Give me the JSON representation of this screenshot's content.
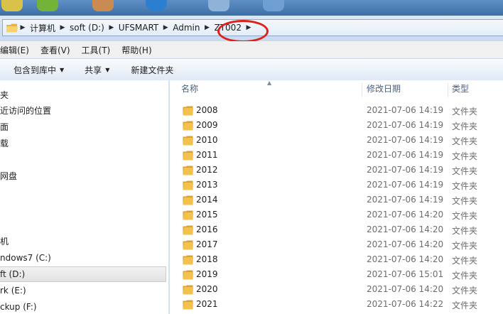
{
  "address": {
    "crumbs": [
      "计算机",
      "soft (D:)",
      "UFSMART",
      "Admin",
      "ZT002"
    ]
  },
  "menu": {
    "items": [
      "编辑(E)",
      "查看(V)",
      "工具(T)",
      "帮助(H)"
    ]
  },
  "toolbar": {
    "include_label": "包含到库中",
    "share_label": "共享",
    "new_folder_label": "新建文件夹"
  },
  "nav": {
    "items": [
      "夹",
      "近访问的位置",
      "面",
      "载",
      "网盘",
      "机",
      "ndows7 (C:)",
      "ft (D:)",
      "rk (E:)",
      "ckup (F:)"
    ]
  },
  "list": {
    "headers": {
      "name": "名称",
      "date": "修改日期",
      "type": "类型"
    },
    "rows": [
      {
        "name": "2008",
        "date": "2021-07-06 14:19",
        "type": "文件夹"
      },
      {
        "name": "2009",
        "date": "2021-07-06 14:19",
        "type": "文件夹"
      },
      {
        "name": "2010",
        "date": "2021-07-06 14:19",
        "type": "文件夹"
      },
      {
        "name": "2011",
        "date": "2021-07-06 14:19",
        "type": "文件夹"
      },
      {
        "name": "2012",
        "date": "2021-07-06 14:19",
        "type": "文件夹"
      },
      {
        "name": "2013",
        "date": "2021-07-06 14:19",
        "type": "文件夹"
      },
      {
        "name": "2014",
        "date": "2021-07-06 14:19",
        "type": "文件夹"
      },
      {
        "name": "2015",
        "date": "2021-07-06 14:20",
        "type": "文件夹"
      },
      {
        "name": "2016",
        "date": "2021-07-06 14:20",
        "type": "文件夹"
      },
      {
        "name": "2017",
        "date": "2021-07-06 14:20",
        "type": "文件夹"
      },
      {
        "name": "2018",
        "date": "2021-07-06 14:20",
        "type": "文件夹"
      },
      {
        "name": "2019",
        "date": "2021-07-06 15:01",
        "type": "文件夹"
      },
      {
        "name": "2020",
        "date": "2021-07-06 14:20",
        "type": "文件夹"
      },
      {
        "name": "2021",
        "date": "2021-07-06 14:22",
        "type": "文件夹"
      }
    ]
  },
  "colors": {
    "highlight_ring": "#e0201a",
    "folder": "#f2c14e"
  }
}
